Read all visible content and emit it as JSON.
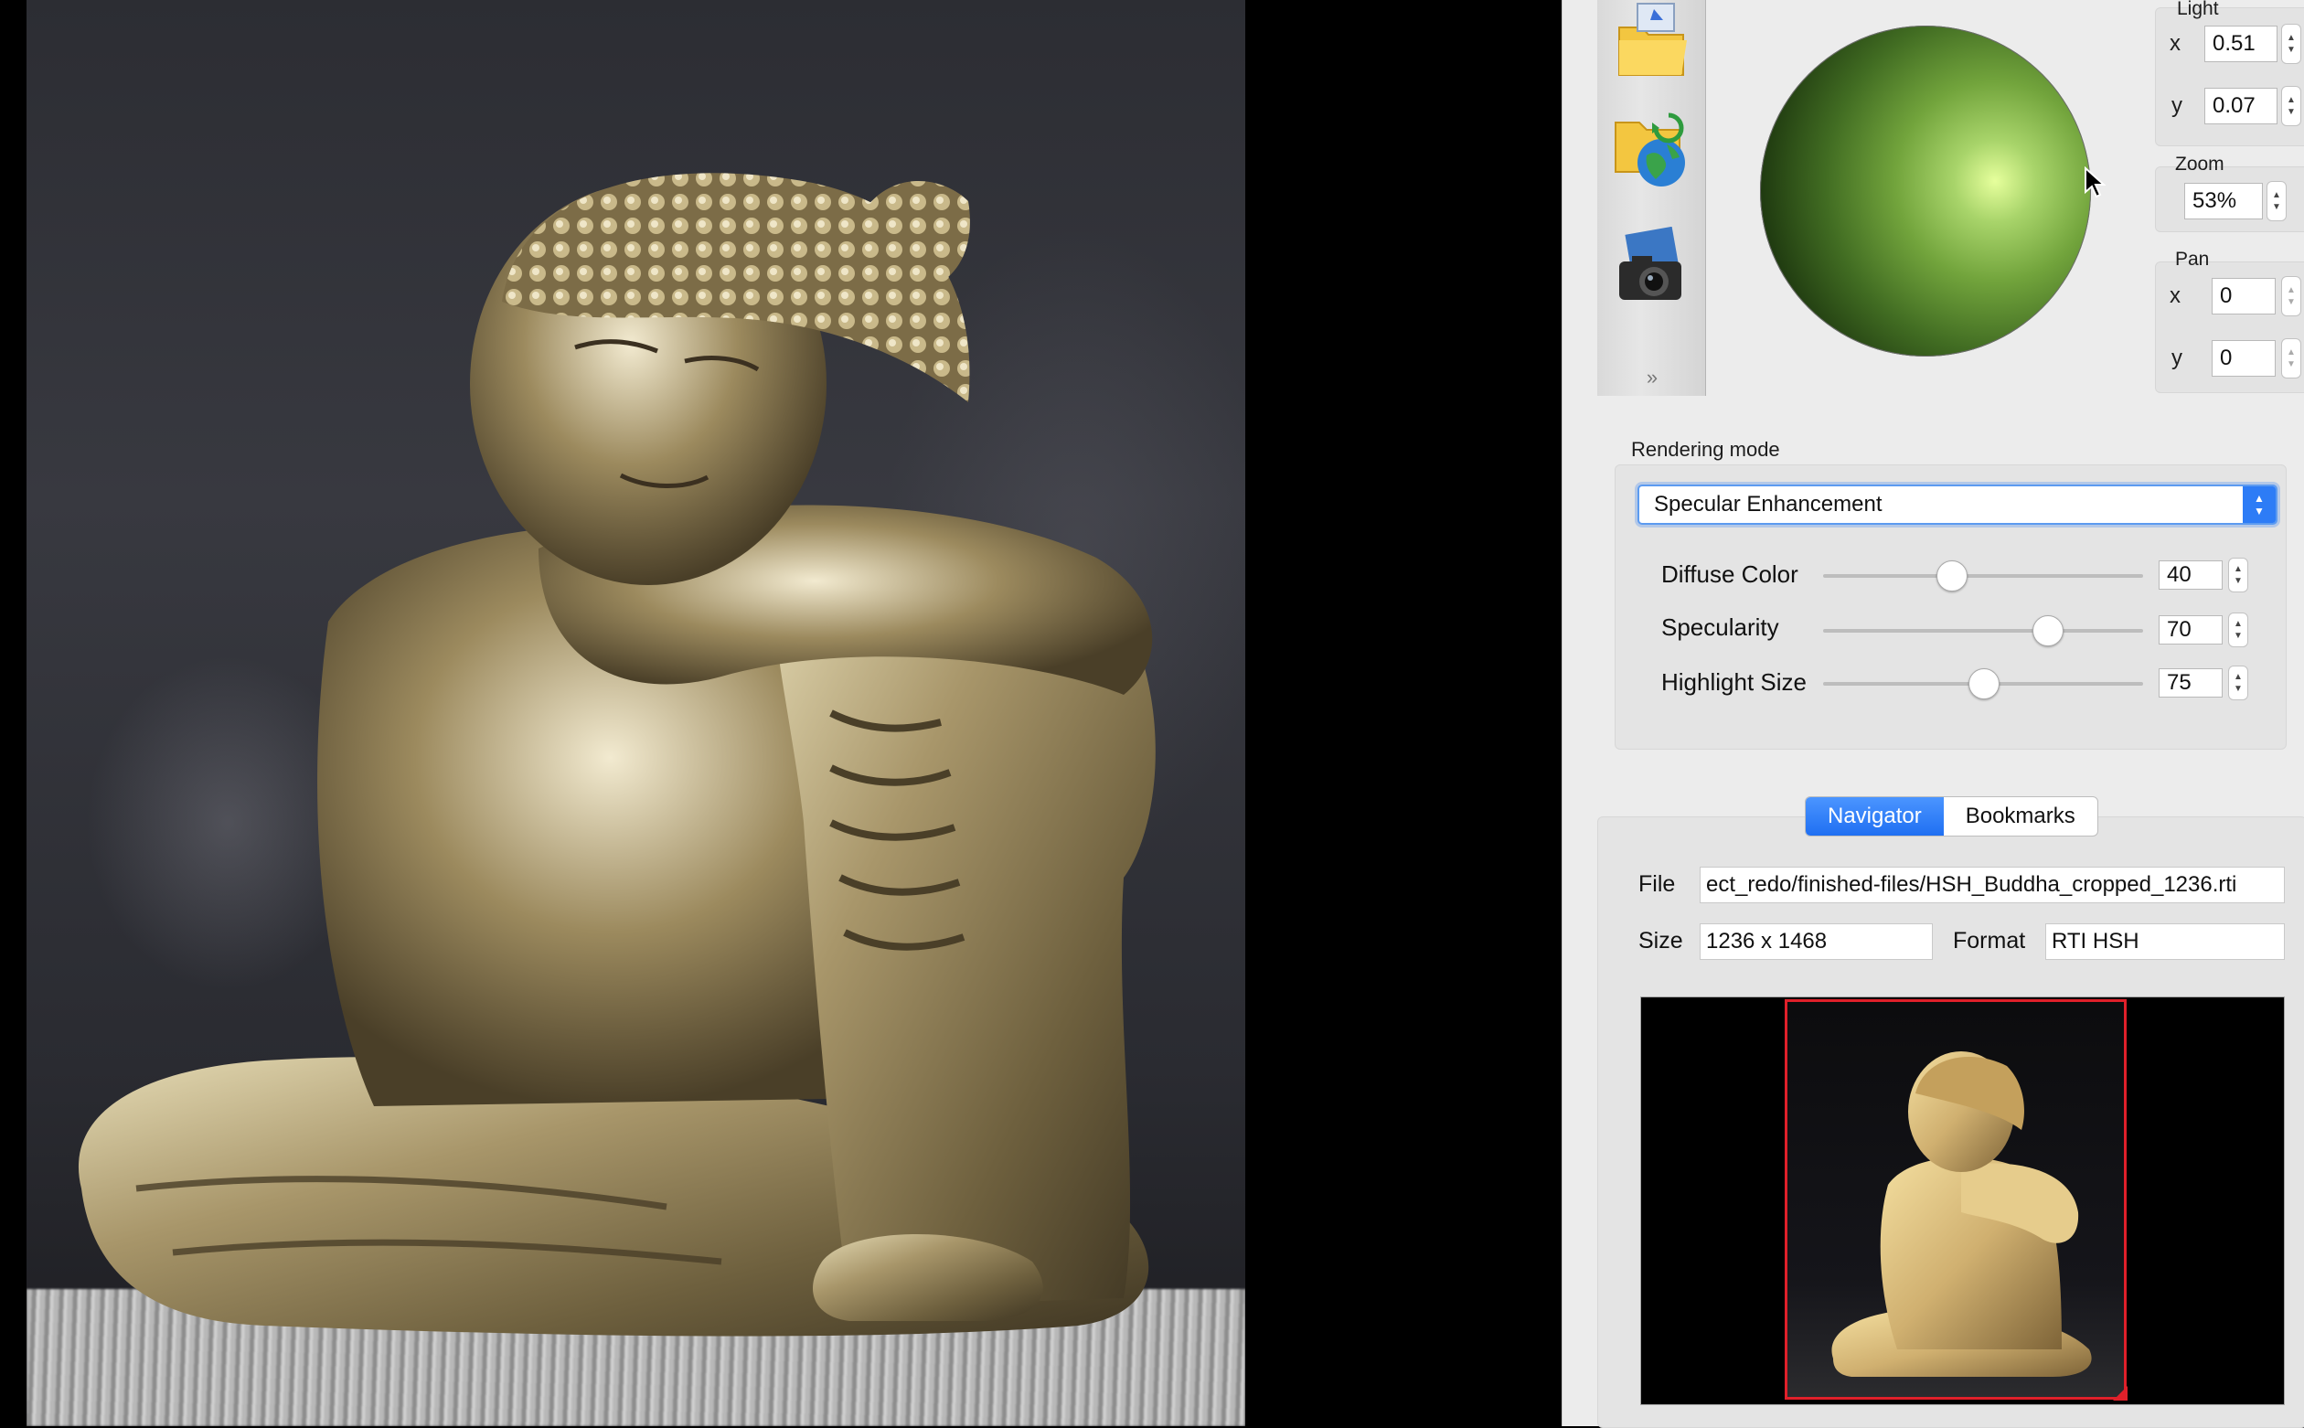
{
  "light": {
    "title": "Light",
    "x_label": "x",
    "x_value": "0.51",
    "y_label": "y",
    "y_value": "0.07"
  },
  "zoom": {
    "title": "Zoom",
    "value": "53%"
  },
  "pan": {
    "title": "Pan",
    "x_label": "x",
    "x_value": "0",
    "y_label": "y",
    "y_value": "0"
  },
  "rendering": {
    "title": "Rendering mode",
    "mode": "Specular Enhancement",
    "sliders": [
      {
        "label": "Diffuse Color",
        "value": "40",
        "level": 0.4
      },
      {
        "label": "Specularity",
        "value": "70",
        "level": 0.7
      },
      {
        "label": "Highlight Size",
        "value": "75",
        "level": 0.5
      }
    ]
  },
  "tabs": [
    {
      "label": "Navigator",
      "active": true
    },
    {
      "label": "Bookmarks",
      "active": false
    }
  ],
  "file_info": {
    "file_label": "File",
    "file_value": "ect_redo/finished-files/HSH_Buddha_cropped_1236.rti",
    "size_label": "Size",
    "size_value": "1236 x 1468",
    "format_label": "Format",
    "format_value": "RTI HSH"
  },
  "icons": {
    "toolstrip": [
      "open-folder-icon",
      "open-remote-folder-icon",
      "snapshot-camera-icon",
      "more-chevron-icon"
    ]
  },
  "colors": {
    "accent": "#2d7cf6",
    "viewport_frame": "#e0202a",
    "sphere_highlight": "#e6ff9c"
  }
}
